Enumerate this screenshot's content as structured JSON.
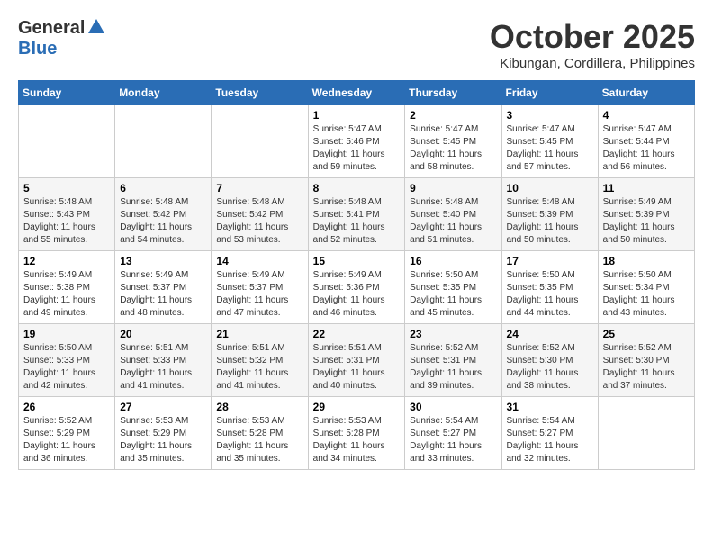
{
  "logo": {
    "general": "General",
    "blue": "Blue"
  },
  "title": "October 2025",
  "location": "Kibungan, Cordillera, Philippines",
  "days_of_week": [
    "Sunday",
    "Monday",
    "Tuesday",
    "Wednesday",
    "Thursday",
    "Friday",
    "Saturday"
  ],
  "weeks": [
    [
      {
        "day": "",
        "info": ""
      },
      {
        "day": "",
        "info": ""
      },
      {
        "day": "",
        "info": ""
      },
      {
        "day": "1",
        "info": "Sunrise: 5:47 AM\nSunset: 5:46 PM\nDaylight: 11 hours\nand 59 minutes."
      },
      {
        "day": "2",
        "info": "Sunrise: 5:47 AM\nSunset: 5:45 PM\nDaylight: 11 hours\nand 58 minutes."
      },
      {
        "day": "3",
        "info": "Sunrise: 5:47 AM\nSunset: 5:45 PM\nDaylight: 11 hours\nand 57 minutes."
      },
      {
        "day": "4",
        "info": "Sunrise: 5:47 AM\nSunset: 5:44 PM\nDaylight: 11 hours\nand 56 minutes."
      }
    ],
    [
      {
        "day": "5",
        "info": "Sunrise: 5:48 AM\nSunset: 5:43 PM\nDaylight: 11 hours\nand 55 minutes."
      },
      {
        "day": "6",
        "info": "Sunrise: 5:48 AM\nSunset: 5:42 PM\nDaylight: 11 hours\nand 54 minutes."
      },
      {
        "day": "7",
        "info": "Sunrise: 5:48 AM\nSunset: 5:42 PM\nDaylight: 11 hours\nand 53 minutes."
      },
      {
        "day": "8",
        "info": "Sunrise: 5:48 AM\nSunset: 5:41 PM\nDaylight: 11 hours\nand 52 minutes."
      },
      {
        "day": "9",
        "info": "Sunrise: 5:48 AM\nSunset: 5:40 PM\nDaylight: 11 hours\nand 51 minutes."
      },
      {
        "day": "10",
        "info": "Sunrise: 5:48 AM\nSunset: 5:39 PM\nDaylight: 11 hours\nand 50 minutes."
      },
      {
        "day": "11",
        "info": "Sunrise: 5:49 AM\nSunset: 5:39 PM\nDaylight: 11 hours\nand 50 minutes."
      }
    ],
    [
      {
        "day": "12",
        "info": "Sunrise: 5:49 AM\nSunset: 5:38 PM\nDaylight: 11 hours\nand 49 minutes."
      },
      {
        "day": "13",
        "info": "Sunrise: 5:49 AM\nSunset: 5:37 PM\nDaylight: 11 hours\nand 48 minutes."
      },
      {
        "day": "14",
        "info": "Sunrise: 5:49 AM\nSunset: 5:37 PM\nDaylight: 11 hours\nand 47 minutes."
      },
      {
        "day": "15",
        "info": "Sunrise: 5:49 AM\nSunset: 5:36 PM\nDaylight: 11 hours\nand 46 minutes."
      },
      {
        "day": "16",
        "info": "Sunrise: 5:50 AM\nSunset: 5:35 PM\nDaylight: 11 hours\nand 45 minutes."
      },
      {
        "day": "17",
        "info": "Sunrise: 5:50 AM\nSunset: 5:35 PM\nDaylight: 11 hours\nand 44 minutes."
      },
      {
        "day": "18",
        "info": "Sunrise: 5:50 AM\nSunset: 5:34 PM\nDaylight: 11 hours\nand 43 minutes."
      }
    ],
    [
      {
        "day": "19",
        "info": "Sunrise: 5:50 AM\nSunset: 5:33 PM\nDaylight: 11 hours\nand 42 minutes."
      },
      {
        "day": "20",
        "info": "Sunrise: 5:51 AM\nSunset: 5:33 PM\nDaylight: 11 hours\nand 41 minutes."
      },
      {
        "day": "21",
        "info": "Sunrise: 5:51 AM\nSunset: 5:32 PM\nDaylight: 11 hours\nand 41 minutes."
      },
      {
        "day": "22",
        "info": "Sunrise: 5:51 AM\nSunset: 5:31 PM\nDaylight: 11 hours\nand 40 minutes."
      },
      {
        "day": "23",
        "info": "Sunrise: 5:52 AM\nSunset: 5:31 PM\nDaylight: 11 hours\nand 39 minutes."
      },
      {
        "day": "24",
        "info": "Sunrise: 5:52 AM\nSunset: 5:30 PM\nDaylight: 11 hours\nand 38 minutes."
      },
      {
        "day": "25",
        "info": "Sunrise: 5:52 AM\nSunset: 5:30 PM\nDaylight: 11 hours\nand 37 minutes."
      }
    ],
    [
      {
        "day": "26",
        "info": "Sunrise: 5:52 AM\nSunset: 5:29 PM\nDaylight: 11 hours\nand 36 minutes."
      },
      {
        "day": "27",
        "info": "Sunrise: 5:53 AM\nSunset: 5:29 PM\nDaylight: 11 hours\nand 35 minutes."
      },
      {
        "day": "28",
        "info": "Sunrise: 5:53 AM\nSunset: 5:28 PM\nDaylight: 11 hours\nand 35 minutes."
      },
      {
        "day": "29",
        "info": "Sunrise: 5:53 AM\nSunset: 5:28 PM\nDaylight: 11 hours\nand 34 minutes."
      },
      {
        "day": "30",
        "info": "Sunrise: 5:54 AM\nSunset: 5:27 PM\nDaylight: 11 hours\nand 33 minutes."
      },
      {
        "day": "31",
        "info": "Sunrise: 5:54 AM\nSunset: 5:27 PM\nDaylight: 11 hours\nand 32 minutes."
      },
      {
        "day": "",
        "info": ""
      }
    ]
  ]
}
